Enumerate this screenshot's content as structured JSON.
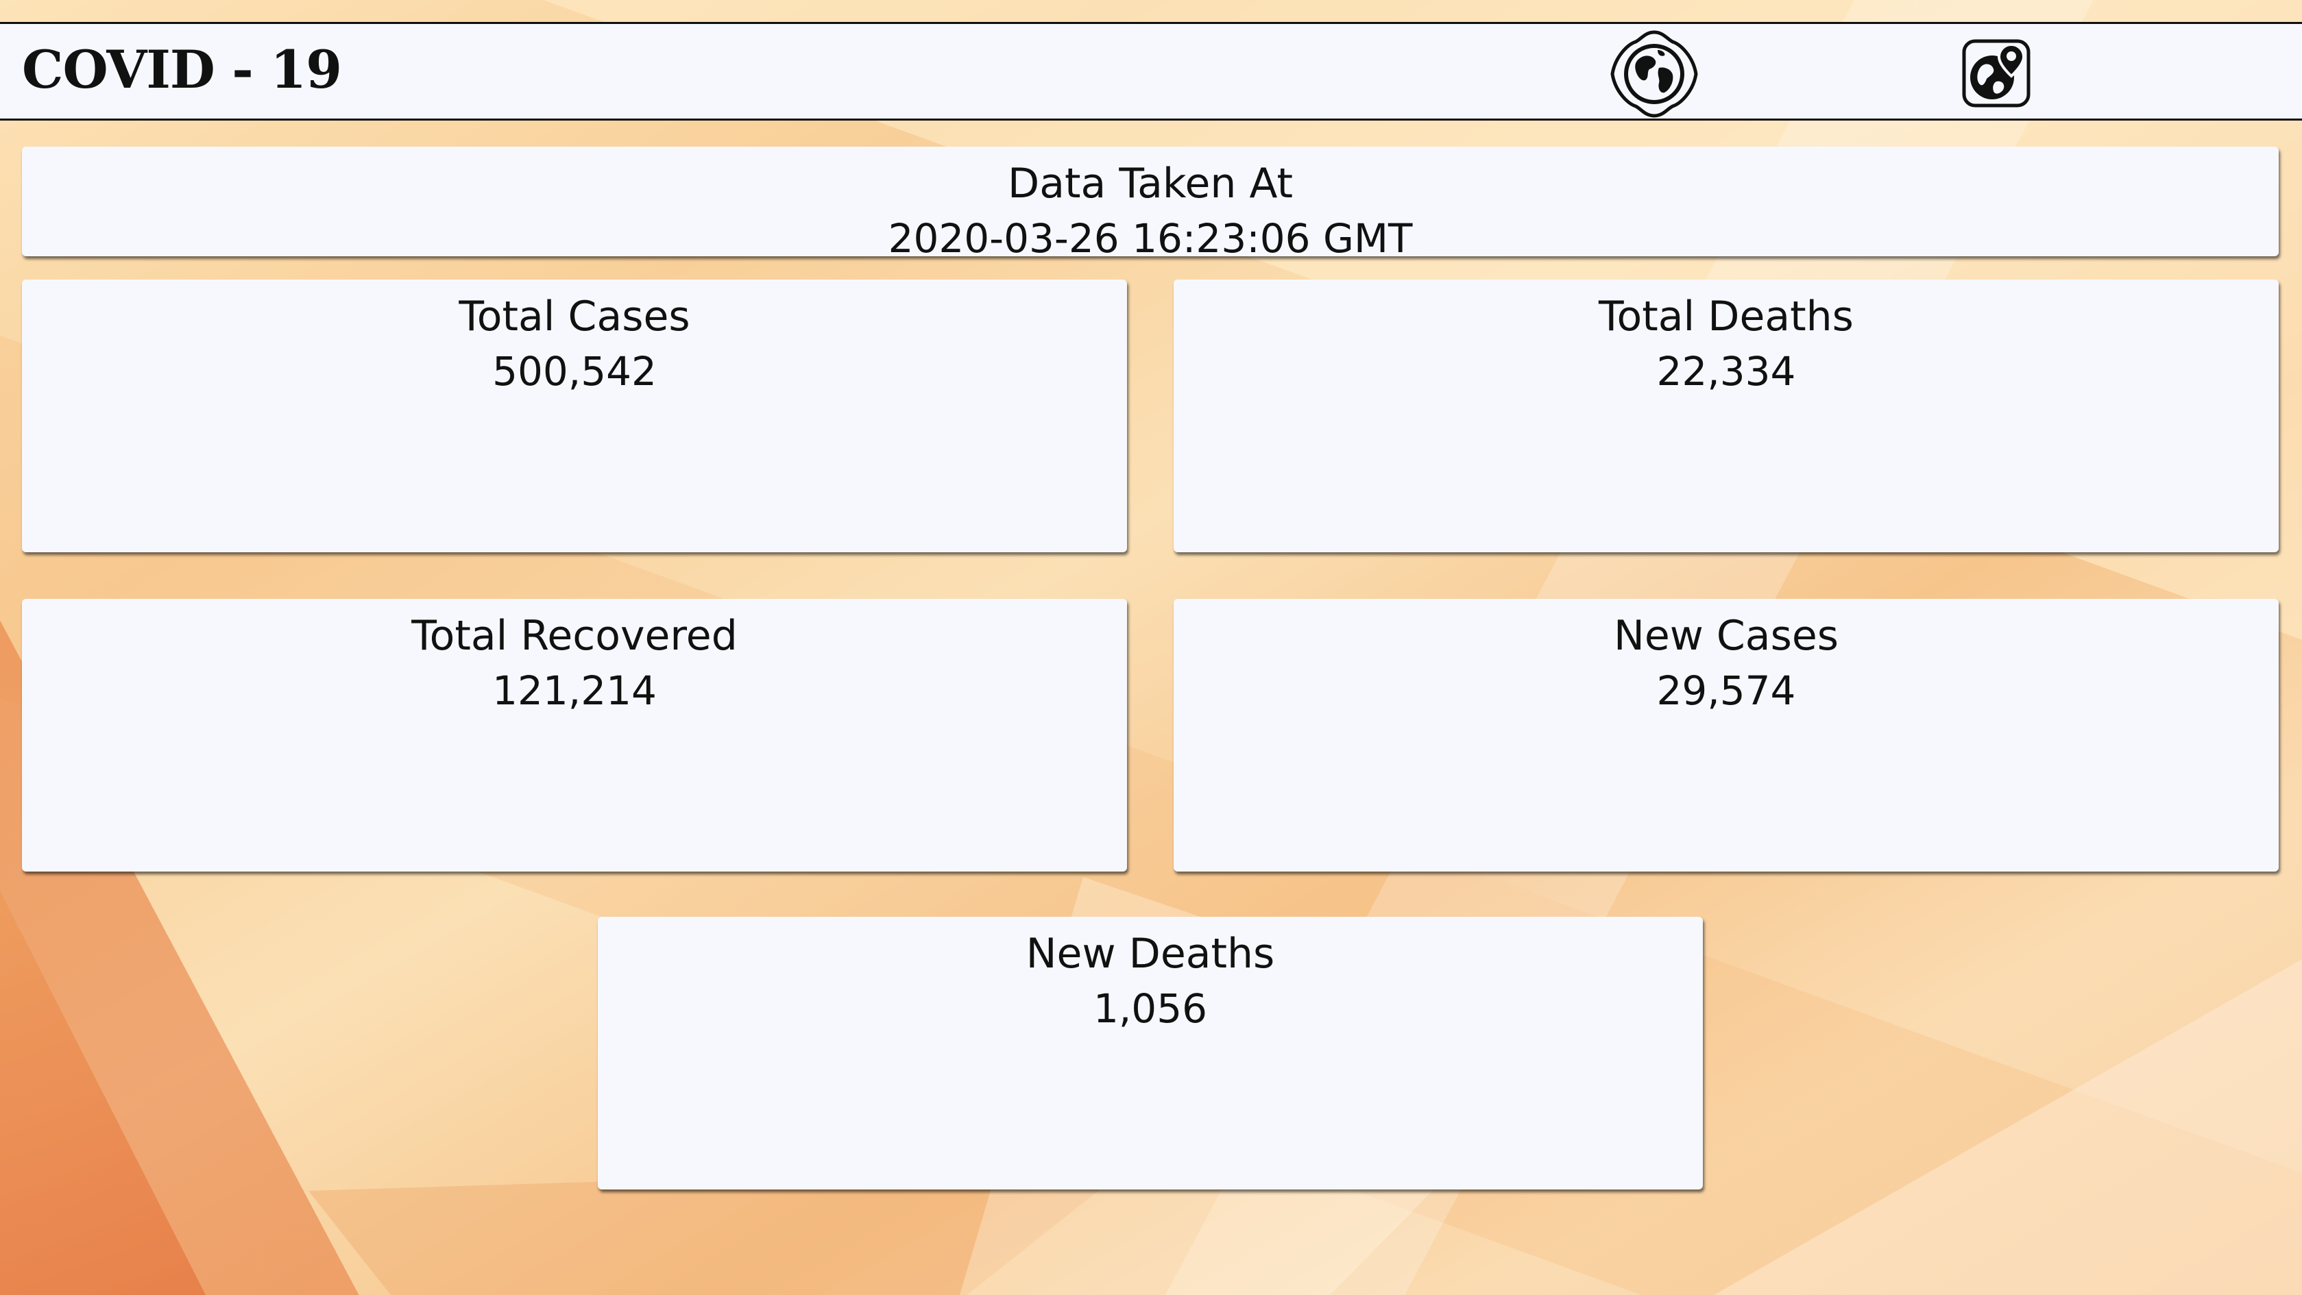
{
  "header": {
    "title": "COVID - 19",
    "icons": [
      {
        "name": "world-globe-icon"
      },
      {
        "name": "map-location-icon"
      }
    ]
  },
  "timestamp": {
    "label": "Data Taken At",
    "value": "2020-03-26 16:23:06 GMT"
  },
  "stats": {
    "total_cases": {
      "label": "Total Cases",
      "value": "500,542"
    },
    "total_deaths": {
      "label": "Total Deaths",
      "value": "22,334"
    },
    "total_recovered": {
      "label": "Total Recovered",
      "value": "121,214"
    },
    "new_cases": {
      "label": "New Cases",
      "value": "29,574"
    },
    "new_deaths": {
      "label": "New Deaths",
      "value": "1,056"
    }
  },
  "colors": {
    "card_background": "#f7f8fd",
    "text": "#111111",
    "background_warm": "#f8cf98",
    "background_accent": "#e67b45"
  }
}
